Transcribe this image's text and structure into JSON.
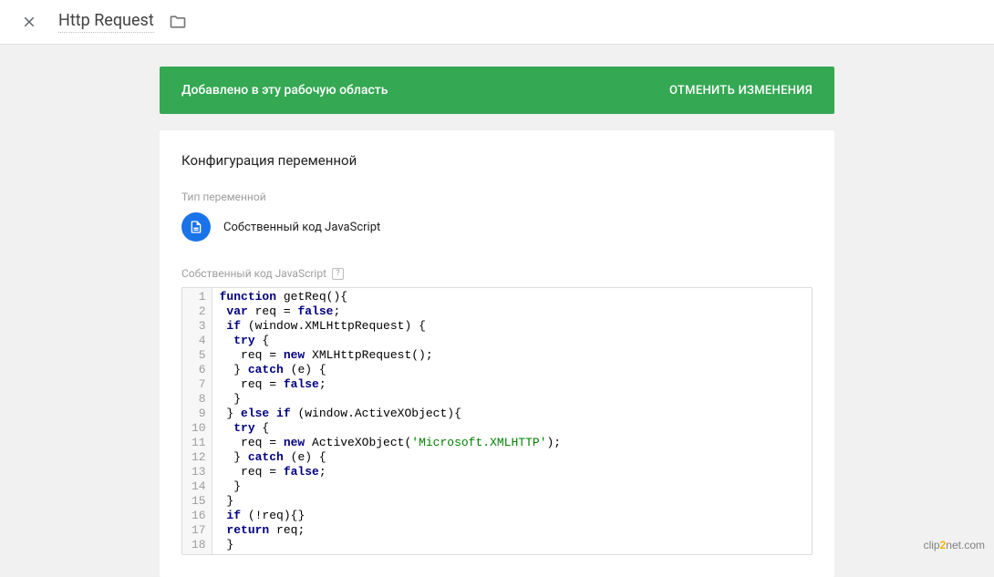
{
  "header": {
    "title": "Http Request"
  },
  "banner": {
    "message": "Добавлено в эту рабочую область",
    "action": "ОТМЕНИТЬ ИЗМЕНЕНИЯ"
  },
  "card": {
    "title": "Конфигурация переменной",
    "type_label": "Тип переменной",
    "type_name": "Собственный код JavaScript",
    "code_label": "Собственный код JavaScript",
    "help": "?"
  },
  "code": {
    "lines": [
      "function getReq(){",
      " var req = false;",
      " if (window.XMLHttpRequest) {",
      "  try {",
      "   req = new XMLHttpRequest();",
      "  } catch (e) {",
      "   req = false;",
      "  }",
      " } else if (window.ActiveXObject){",
      "  try {",
      "   req = new ActiveXObject('Microsoft.XMLHTTP');",
      "  } catch (e) {",
      "   req = false;",
      "  }",
      " }",
      " if (!req){}",
      " return req;",
      " }"
    ],
    "gutter": [
      "1",
      "2",
      "3",
      "4",
      "5",
      "6",
      "7",
      "8",
      "9",
      "10",
      "11",
      "12",
      "13",
      "14",
      "15",
      "16",
      "17",
      "18"
    ]
  },
  "watermark": {
    "pre": "clip",
    "mid": "2",
    "post": "net",
    "tld": ".com"
  }
}
